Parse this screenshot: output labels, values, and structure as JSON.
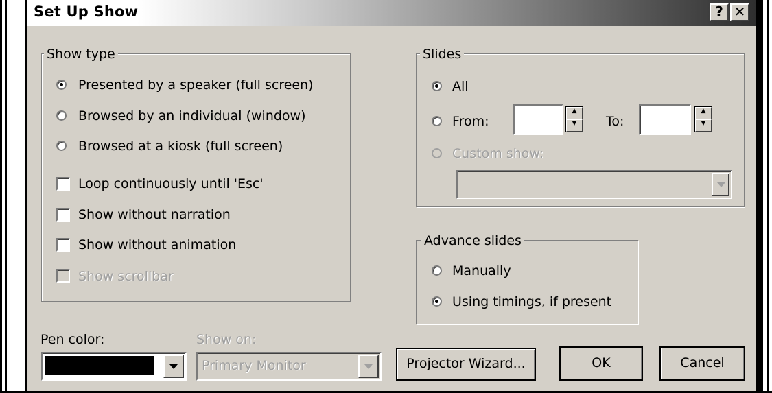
{
  "window": {
    "title": "Set Up Show",
    "help_label": "?",
    "close_label": "✕"
  },
  "show_type": {
    "label": "Show type",
    "options": [
      {
        "label": "Presented by a speaker (full screen)",
        "selected": true
      },
      {
        "label": "Browsed by an individual (window)",
        "selected": false
      },
      {
        "label": "Browsed at a kiosk (full screen)",
        "selected": false
      }
    ],
    "checks": [
      {
        "label": "Loop continuously until 'Esc'",
        "checked": false,
        "enabled": true
      },
      {
        "label": "Show without narration",
        "checked": false,
        "enabled": true
      },
      {
        "label": "Show without animation",
        "checked": false,
        "enabled": true
      },
      {
        "label": "Show scrollbar",
        "checked": false,
        "enabled": false
      }
    ]
  },
  "slides": {
    "label": "Slides",
    "all_label": "All",
    "from_label": "From:",
    "from_value": "",
    "to_label": "To:",
    "to_value": "",
    "custom_label": "Custom show:",
    "custom_value": ""
  },
  "advance": {
    "label": "Advance slides",
    "manual_label": "Manually",
    "timings_label": "Using timings, if present",
    "selected": "timings"
  },
  "pen_color": {
    "label": "Pen color:",
    "value_color": "#000000"
  },
  "show_on": {
    "label": "Show on:",
    "value": "Primary Monitor"
  },
  "buttons": {
    "projector_wizard": "Projector Wizard...",
    "ok": "OK",
    "cancel": "Cancel"
  }
}
